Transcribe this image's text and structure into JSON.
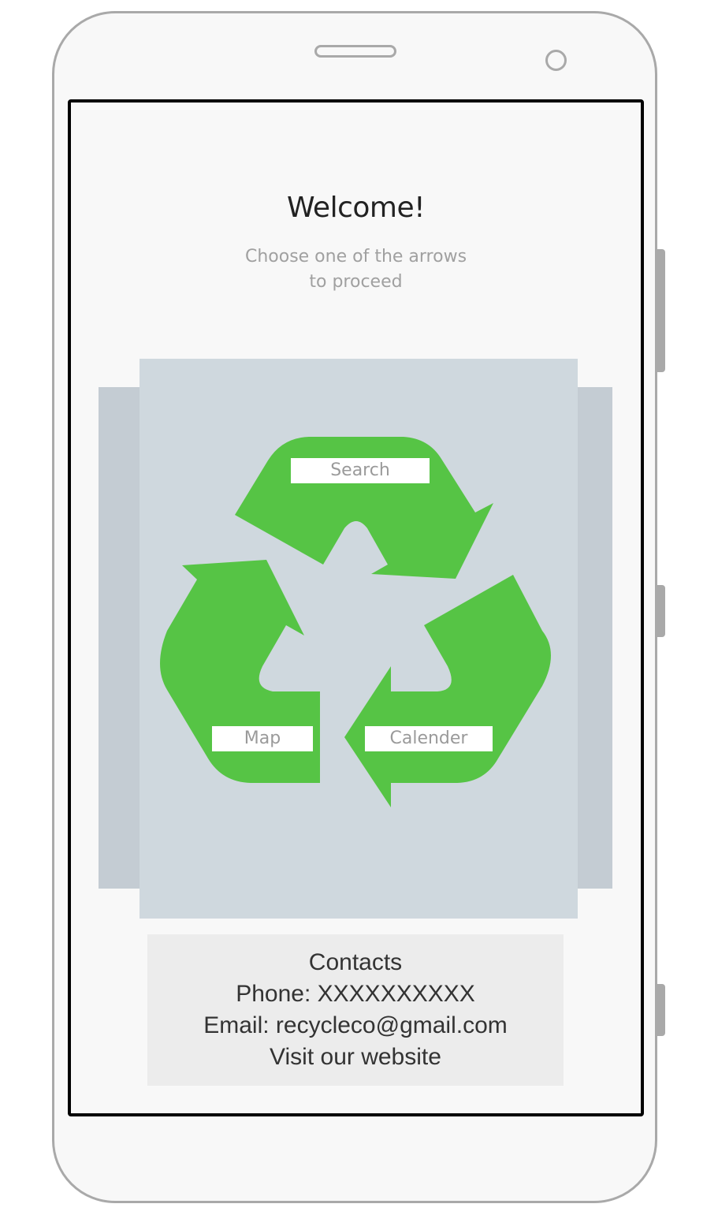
{
  "header": {
    "title": "Welcome!",
    "subtitle_line1": "Choose one of the arrows",
    "subtitle_line2": "to proceed"
  },
  "arrows": {
    "search_label": "Search",
    "map_label": "Map",
    "calendar_label": "Calender"
  },
  "contacts": {
    "heading": "Contacts",
    "phone": "Phone: XXXXXXXXXX",
    "email": "Email: recycleco@gmail.com",
    "website": "Visit our website"
  },
  "colors": {
    "recycle_green": "#56c445",
    "card": "#cfd8de"
  },
  "icons": [
    "recycle-icon"
  ]
}
